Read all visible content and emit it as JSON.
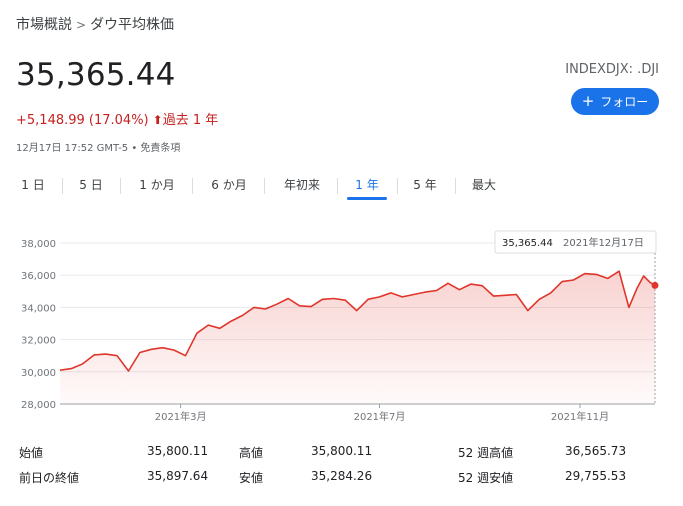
{
  "breadcrumb": {
    "parent": "市場概説",
    "separator": ">",
    "current": "ダウ平均株価"
  },
  "quote": {
    "price": "35,365.44",
    "change": "+5,148.99 (17.04%)",
    "period": "過去 1 年",
    "timestamp": "12月17日 17:52 GMT-5 • 免責条項",
    "ticker": "INDEXDJX: .DJI"
  },
  "follow_button": {
    "label": "フォロー"
  },
  "tabs": [
    "1 日",
    "5 日",
    "1 か月",
    "6 か月",
    "年初来",
    "1 年",
    "5 年",
    "最大"
  ],
  "active_tab": "1 年",
  "tooltip": {
    "value": "35,365.44",
    "date": "2021年12月17日"
  },
  "colors": {
    "accent": "#1a73e8",
    "line": "#e0352b",
    "change": "#c5221f"
  },
  "chart_data": {
    "type": "area",
    "yticks": [
      "38,000",
      "36,000",
      "34,000",
      "32,000",
      "30,000",
      "28,000"
    ],
    "ylim": [
      28000,
      38000
    ],
    "xticks": [
      {
        "label": "2021年3月",
        "x": "2021-03-01"
      },
      {
        "label": "2021年7月",
        "x": "2021-07-01"
      },
      {
        "label": "2021年11月",
        "x": "2021-11-01"
      }
    ],
    "xlim": [
      "2020-12-17",
      "2021-12-17"
    ],
    "series": [
      {
        "x": [
          "2020-12-17",
          "2020-12-24",
          "2020-12-31",
          "2021-01-07",
          "2021-01-14",
          "2021-01-21",
          "2021-01-28",
          "2021-02-04",
          "2021-02-11",
          "2021-02-18",
          "2021-02-25",
          "2021-03-04",
          "2021-03-11",
          "2021-03-18",
          "2021-03-25",
          "2021-04-01",
          "2021-04-08",
          "2021-04-15",
          "2021-04-22",
          "2021-04-29",
          "2021-05-06",
          "2021-05-13",
          "2021-05-20",
          "2021-05-27",
          "2021-06-03",
          "2021-06-10",
          "2021-06-17",
          "2021-06-24",
          "2021-07-01",
          "2021-07-08",
          "2021-07-15",
          "2021-07-22",
          "2021-07-29",
          "2021-08-05",
          "2021-08-12",
          "2021-08-19",
          "2021-08-26",
          "2021-09-02",
          "2021-09-09",
          "2021-09-16",
          "2021-09-23",
          "2021-09-30",
          "2021-10-07",
          "2021-10-14",
          "2021-10-21",
          "2021-10-28",
          "2021-11-04",
          "2021-11-11",
          "2021-11-18",
          "2021-11-25",
          "2021-12-01",
          "2021-12-06",
          "2021-12-10",
          "2021-12-14",
          "2021-12-17"
        ],
        "values": [
          30100,
          30200,
          30500,
          31050,
          31100,
          31000,
          30050,
          31200,
          31400,
          31500,
          31350,
          31000,
          32400,
          32900,
          32700,
          33150,
          33500,
          34000,
          33900,
          34200,
          34550,
          34100,
          34050,
          34500,
          34550,
          34450,
          33800,
          34500,
          34650,
          34900,
          34650,
          34800,
          34950,
          35050,
          35500,
          35100,
          35450,
          35350,
          34700,
          34750,
          34800,
          33800,
          34500,
          34900,
          35600,
          35700,
          36100,
          36050,
          35800,
          36250,
          34000,
          35200,
          35950,
          35550,
          35365
        ]
      }
    ]
  },
  "stats": [
    {
      "label": "始値",
      "value": "35,800.11"
    },
    {
      "label": "高値",
      "value": "35,800.11"
    },
    {
      "label": "52 週高値",
      "value": "36,565.73"
    },
    {
      "label": "前日の終値",
      "value": "35,897.64"
    },
    {
      "label": "安値",
      "value": "35,284.26"
    },
    {
      "label": "52 週安値",
      "value": "29,755.53"
    }
  ]
}
